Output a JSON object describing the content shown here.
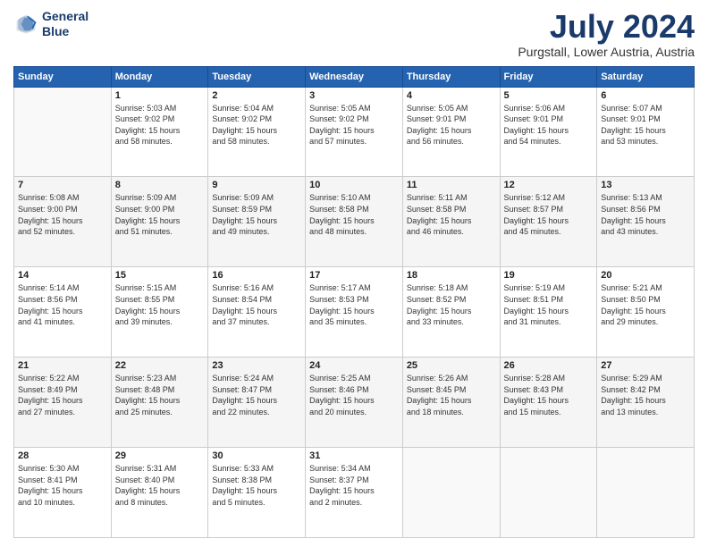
{
  "logo": {
    "line1": "General",
    "line2": "Blue"
  },
  "title": "July 2024",
  "location": "Purgstall, Lower Austria, Austria",
  "days_of_week": [
    "Sunday",
    "Monday",
    "Tuesday",
    "Wednesday",
    "Thursday",
    "Friday",
    "Saturday"
  ],
  "weeks": [
    [
      {
        "day": "",
        "info": ""
      },
      {
        "day": "1",
        "info": "Sunrise: 5:03 AM\nSunset: 9:02 PM\nDaylight: 15 hours\nand 58 minutes."
      },
      {
        "day": "2",
        "info": "Sunrise: 5:04 AM\nSunset: 9:02 PM\nDaylight: 15 hours\nand 58 minutes."
      },
      {
        "day": "3",
        "info": "Sunrise: 5:05 AM\nSunset: 9:02 PM\nDaylight: 15 hours\nand 57 minutes."
      },
      {
        "day": "4",
        "info": "Sunrise: 5:05 AM\nSunset: 9:01 PM\nDaylight: 15 hours\nand 56 minutes."
      },
      {
        "day": "5",
        "info": "Sunrise: 5:06 AM\nSunset: 9:01 PM\nDaylight: 15 hours\nand 54 minutes."
      },
      {
        "day": "6",
        "info": "Sunrise: 5:07 AM\nSunset: 9:01 PM\nDaylight: 15 hours\nand 53 minutes."
      }
    ],
    [
      {
        "day": "7",
        "info": "Sunrise: 5:08 AM\nSunset: 9:00 PM\nDaylight: 15 hours\nand 52 minutes."
      },
      {
        "day": "8",
        "info": "Sunrise: 5:09 AM\nSunset: 9:00 PM\nDaylight: 15 hours\nand 51 minutes."
      },
      {
        "day": "9",
        "info": "Sunrise: 5:09 AM\nSunset: 8:59 PM\nDaylight: 15 hours\nand 49 minutes."
      },
      {
        "day": "10",
        "info": "Sunrise: 5:10 AM\nSunset: 8:58 PM\nDaylight: 15 hours\nand 48 minutes."
      },
      {
        "day": "11",
        "info": "Sunrise: 5:11 AM\nSunset: 8:58 PM\nDaylight: 15 hours\nand 46 minutes."
      },
      {
        "day": "12",
        "info": "Sunrise: 5:12 AM\nSunset: 8:57 PM\nDaylight: 15 hours\nand 45 minutes."
      },
      {
        "day": "13",
        "info": "Sunrise: 5:13 AM\nSunset: 8:56 PM\nDaylight: 15 hours\nand 43 minutes."
      }
    ],
    [
      {
        "day": "14",
        "info": "Sunrise: 5:14 AM\nSunset: 8:56 PM\nDaylight: 15 hours\nand 41 minutes."
      },
      {
        "day": "15",
        "info": "Sunrise: 5:15 AM\nSunset: 8:55 PM\nDaylight: 15 hours\nand 39 minutes."
      },
      {
        "day": "16",
        "info": "Sunrise: 5:16 AM\nSunset: 8:54 PM\nDaylight: 15 hours\nand 37 minutes."
      },
      {
        "day": "17",
        "info": "Sunrise: 5:17 AM\nSunset: 8:53 PM\nDaylight: 15 hours\nand 35 minutes."
      },
      {
        "day": "18",
        "info": "Sunrise: 5:18 AM\nSunset: 8:52 PM\nDaylight: 15 hours\nand 33 minutes."
      },
      {
        "day": "19",
        "info": "Sunrise: 5:19 AM\nSunset: 8:51 PM\nDaylight: 15 hours\nand 31 minutes."
      },
      {
        "day": "20",
        "info": "Sunrise: 5:21 AM\nSunset: 8:50 PM\nDaylight: 15 hours\nand 29 minutes."
      }
    ],
    [
      {
        "day": "21",
        "info": "Sunrise: 5:22 AM\nSunset: 8:49 PM\nDaylight: 15 hours\nand 27 minutes."
      },
      {
        "day": "22",
        "info": "Sunrise: 5:23 AM\nSunset: 8:48 PM\nDaylight: 15 hours\nand 25 minutes."
      },
      {
        "day": "23",
        "info": "Sunrise: 5:24 AM\nSunset: 8:47 PM\nDaylight: 15 hours\nand 22 minutes."
      },
      {
        "day": "24",
        "info": "Sunrise: 5:25 AM\nSunset: 8:46 PM\nDaylight: 15 hours\nand 20 minutes."
      },
      {
        "day": "25",
        "info": "Sunrise: 5:26 AM\nSunset: 8:45 PM\nDaylight: 15 hours\nand 18 minutes."
      },
      {
        "day": "26",
        "info": "Sunrise: 5:28 AM\nSunset: 8:43 PM\nDaylight: 15 hours\nand 15 minutes."
      },
      {
        "day": "27",
        "info": "Sunrise: 5:29 AM\nSunset: 8:42 PM\nDaylight: 15 hours\nand 13 minutes."
      }
    ],
    [
      {
        "day": "28",
        "info": "Sunrise: 5:30 AM\nSunset: 8:41 PM\nDaylight: 15 hours\nand 10 minutes."
      },
      {
        "day": "29",
        "info": "Sunrise: 5:31 AM\nSunset: 8:40 PM\nDaylight: 15 hours\nand 8 minutes."
      },
      {
        "day": "30",
        "info": "Sunrise: 5:33 AM\nSunset: 8:38 PM\nDaylight: 15 hours\nand 5 minutes."
      },
      {
        "day": "31",
        "info": "Sunrise: 5:34 AM\nSunset: 8:37 PM\nDaylight: 15 hours\nand 2 minutes."
      },
      {
        "day": "",
        "info": ""
      },
      {
        "day": "",
        "info": ""
      },
      {
        "day": "",
        "info": ""
      }
    ]
  ]
}
